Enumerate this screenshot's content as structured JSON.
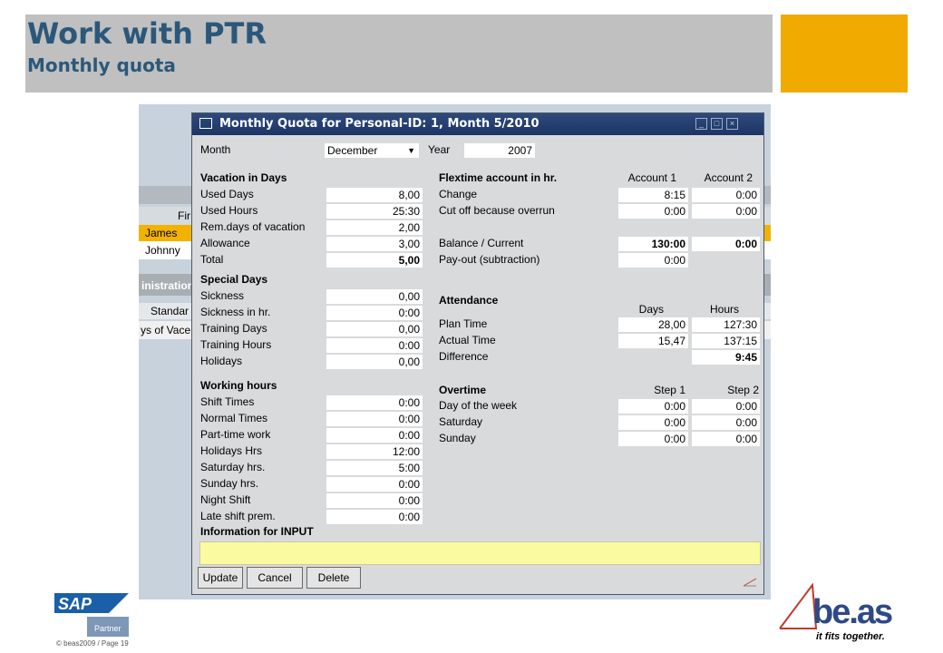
{
  "slide": {
    "title": "Work with PTR",
    "subtitle": "Monthly quota",
    "copyright": "© beas2009 / Page 19",
    "colors": {
      "title": "#2b587a",
      "accent": "#f0aa00",
      "header_bar": "#c0c0c0"
    }
  },
  "background_app": {
    "column_header": "Fir",
    "names": [
      "James",
      "Johnny"
    ],
    "section_label": "inistration",
    "tab_label": "Standar",
    "row_label": "ys of Vace"
  },
  "dialog": {
    "title": "Monthly Quota for Personal-ID: 1, Month 5/2010",
    "month_label": "Month",
    "month_value": "December",
    "year_label": "Year",
    "year_value": "2007",
    "vacation": {
      "header": "Vacation in Days",
      "rows": [
        {
          "label": "Used Days",
          "value": "8,00"
        },
        {
          "label": "Used Hours",
          "value": "25:30"
        },
        {
          "label": "Rem.days of vacation",
          "value": "2,00"
        },
        {
          "label": "Allowance",
          "value": "3,00"
        },
        {
          "label": "Total",
          "value": "5,00"
        }
      ]
    },
    "special": {
      "header": "Special Days",
      "rows": [
        {
          "label": "Sickness",
          "value": "0,00"
        },
        {
          "label": "Sickness in hr.",
          "value": "0:00"
        },
        {
          "label": "Training Days",
          "value": "0,00"
        },
        {
          "label": "Training Hours",
          "value": "0:00"
        },
        {
          "label": "Holidays",
          "value": "0,00"
        }
      ]
    },
    "working": {
      "header": "Working hours",
      "rows": [
        {
          "label": "Shift Times",
          "value": "0:00"
        },
        {
          "label": "Normal Times",
          "value": "0:00"
        },
        {
          "label": "Part-time work",
          "value": "0:00"
        },
        {
          "label": "Holidays Hrs",
          "value": "12:00"
        },
        {
          "label": "Saturday hrs.",
          "value": "5:00"
        },
        {
          "label": "Sunday hrs.",
          "value": "0:00"
        },
        {
          "label": "Night Shift",
          "value": "0:00"
        },
        {
          "label": "Late shift prem.",
          "value": "0:00"
        }
      ]
    },
    "info_header": "Information for INPUT",
    "flextime": {
      "header": "Flextime account in hr.",
      "col1": "Account 1",
      "col2": "Account 2",
      "rows": [
        {
          "label": "Change",
          "v1": "8:15",
          "v2": "0:00"
        },
        {
          "label": "Cut off because overrun",
          "v1": "0:00",
          "v2": "0:00"
        },
        {
          "label": "Balance / Current",
          "v1": "130:00",
          "v2": "0:00"
        },
        {
          "label": "Pay-out (subtraction)",
          "v1": "0:00"
        }
      ]
    },
    "attendance": {
      "header": "Attendance",
      "col1": "Days",
      "col2": "Hours",
      "rows": [
        {
          "label": "Plan Time",
          "v1": "28,00",
          "v2": "127:30"
        },
        {
          "label": "Actual Time",
          "v1": "15,47",
          "v2": "137:15"
        },
        {
          "label": "Difference",
          "v2": "9:45"
        }
      ]
    },
    "overtime": {
      "header": "Overtime",
      "col1": "Step 1",
      "col2": "Step 2",
      "rows": [
        {
          "label": "Day of the week",
          "v1": "0:00",
          "v2": "0:00"
        },
        {
          "label": "Saturday",
          "v1": "0:00",
          "v2": "0:00"
        },
        {
          "label": "Sunday",
          "v1": "0:00",
          "v2": "0:00"
        }
      ]
    },
    "buttons": {
      "update": "Update",
      "cancel": "Cancel",
      "delete": "Delete"
    }
  },
  "logos": {
    "sap": "SAP",
    "sap_partner": "Partner",
    "beas": "be.as",
    "beas_tagline": "it fits together."
  }
}
